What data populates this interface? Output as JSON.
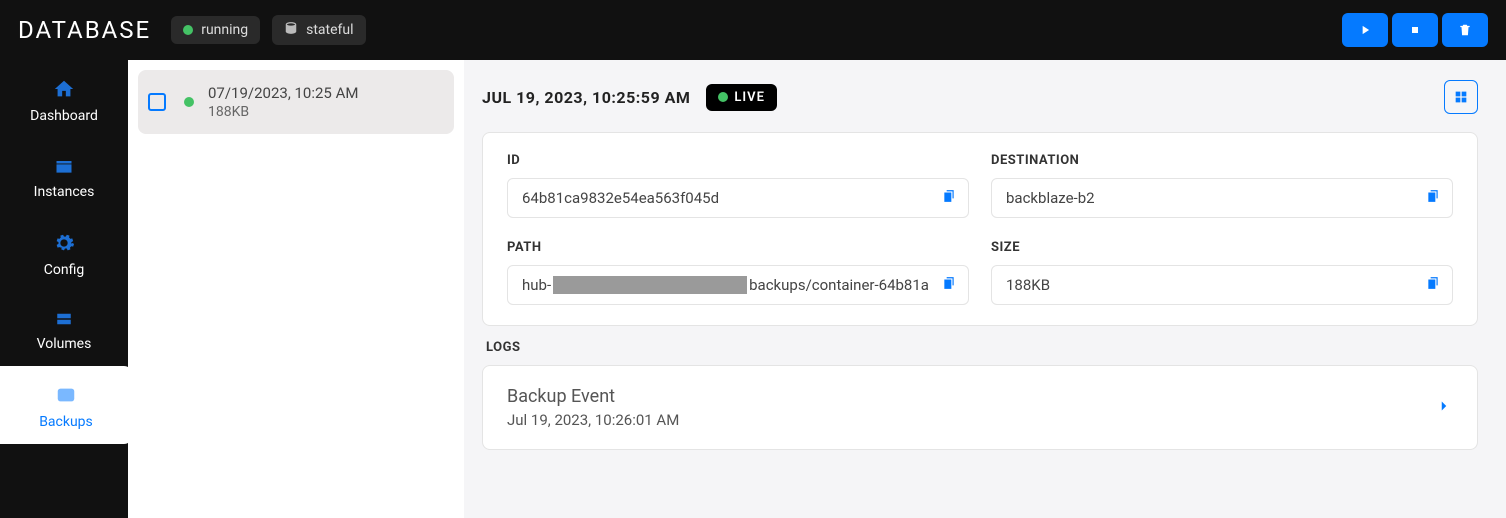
{
  "header": {
    "title": "DATABASE",
    "status_label": "running",
    "mode_label": "stateful"
  },
  "sidebar": {
    "items": [
      {
        "label": "Dashboard"
      },
      {
        "label": "Instances"
      },
      {
        "label": "Config"
      },
      {
        "label": "Volumes"
      },
      {
        "label": "Backups"
      }
    ]
  },
  "list": {
    "items": [
      {
        "date": "07/19/2023, 10:25 AM",
        "size": "188KB"
      }
    ]
  },
  "detail": {
    "timestamp": "JUL 19, 2023, 10:25:59 AM",
    "live_label": "LIVE",
    "labels": {
      "id": "ID",
      "destination": "DESTINATION",
      "path": "PATH",
      "size": "SIZE",
      "logs": "LOGS"
    },
    "id": "64b81ca9832e54ea563f045d",
    "destination": "backblaze-b2",
    "path_prefix": "hub-",
    "path_suffix": "backups/container-64b81a",
    "size": "188KB",
    "log": {
      "title": "Backup Event",
      "time": "Jul 19, 2023, 10:26:01 AM"
    }
  }
}
